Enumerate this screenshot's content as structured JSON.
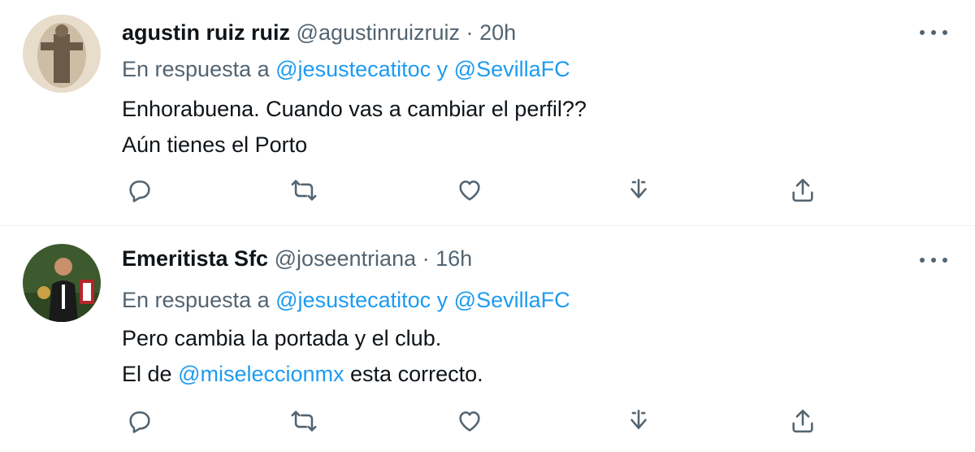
{
  "colors": {
    "accent": "#1d9bf0",
    "secondary_text": "#536471",
    "primary_text": "#0f1419",
    "divider": "#eff3f4"
  },
  "tweets": [
    {
      "name": "agustin ruiz ruiz",
      "handle": "@agustinruizruiz",
      "dot": "·",
      "time": "20h",
      "reply_prefix": "En respuesta a",
      "reply_mention_1": "@jesustecatitoc",
      "reply_joiner": "y",
      "reply_mention_2": "@SevillaFC",
      "lines": {
        "line1": "Enhorabuena. Cuando vas a cambiar el perfil??",
        "line2": "Aún tienes el Porto"
      },
      "icons": [
        "reply-icon",
        "retweet-icon",
        "like-icon",
        "save-icon",
        "share-icon"
      ]
    },
    {
      "name": "Emeritista Sfc",
      "handle": "@joseentriana",
      "dot": "·",
      "time": "16h",
      "reply_prefix": "En respuesta a",
      "reply_mention_1": "@jesustecatitoc",
      "reply_joiner": "y",
      "reply_mention_2": "@SevillaFC",
      "lines": {
        "line1": "Pero cambia la portada y el club.",
        "line2_prefix": "El de",
        "line2_mention": "@mis eleccionmx",
        "line2_suffix": "esta correcto."
      },
      "icons": [
        "reply-icon",
        "retweet-icon",
        "like-icon",
        "save-icon",
        "share-icon"
      ]
    }
  ]
}
